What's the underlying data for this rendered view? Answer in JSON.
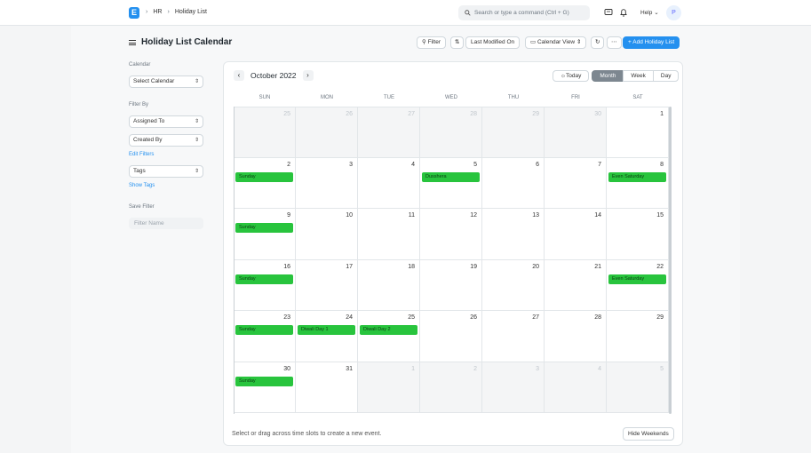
{
  "navbar": {
    "logo_letter": "E",
    "breadcrumbs": [
      "HR",
      "Holiday List"
    ],
    "search_placeholder": "Search or type a command (Ctrl + G)",
    "help_label": "Help",
    "avatar_initial": "P"
  },
  "page": {
    "title": "Holiday List Calendar",
    "toolbar": {
      "filter_label": "Filter",
      "sort_label": "Last Modified On",
      "view_label": "Calendar View",
      "add_label": "+ Add Holiday List"
    }
  },
  "sidebar": {
    "calendar_label": "Calendar",
    "select_calendar": "Select Calendar",
    "filter_by_label": "Filter By",
    "assigned_to": "Assigned To",
    "created_by": "Created By",
    "edit_filters": "Edit Filters",
    "tags": "Tags",
    "show_tags": "Show Tags",
    "save_filter_label": "Save Filter",
    "filter_name_placeholder": "Filter Name"
  },
  "calendar": {
    "month_title": "October 2022",
    "views": [
      "Today",
      "Month",
      "Week",
      "Day"
    ],
    "active_view": "Month",
    "weekdays": [
      "SUN",
      "MON",
      "TUE",
      "WED",
      "THU",
      "FRI",
      "SAT"
    ],
    "weeks": [
      [
        {
          "d": "25",
          "o": true
        },
        {
          "d": "26",
          "o": true
        },
        {
          "d": "27",
          "o": true
        },
        {
          "d": "28",
          "o": true
        },
        {
          "d": "29",
          "o": true
        },
        {
          "d": "30",
          "o": true
        },
        {
          "d": "1"
        }
      ],
      [
        {
          "d": "2",
          "e": "Sunday"
        },
        {
          "d": "3"
        },
        {
          "d": "4"
        },
        {
          "d": "5",
          "e": "Dusshera"
        },
        {
          "d": "6"
        },
        {
          "d": "7"
        },
        {
          "d": "8",
          "e": "Even Saturday"
        }
      ],
      [
        {
          "d": "9",
          "e": "Sunday"
        },
        {
          "d": "10"
        },
        {
          "d": "11"
        },
        {
          "d": "12"
        },
        {
          "d": "13"
        },
        {
          "d": "14"
        },
        {
          "d": "15"
        }
      ],
      [
        {
          "d": "16",
          "e": "Sunday"
        },
        {
          "d": "17"
        },
        {
          "d": "18"
        },
        {
          "d": "19"
        },
        {
          "d": "20"
        },
        {
          "d": "21"
        },
        {
          "d": "22",
          "e": "Even Saturday"
        }
      ],
      [
        {
          "d": "23",
          "e": "Sunday"
        },
        {
          "d": "24",
          "e": "Diwali Day 1"
        },
        {
          "d": "25",
          "e": "Diwali Day 2"
        },
        {
          "d": "26"
        },
        {
          "d": "27"
        },
        {
          "d": "28"
        },
        {
          "d": "29"
        }
      ],
      [
        {
          "d": "30",
          "e": "Sunday"
        },
        {
          "d": "31"
        },
        {
          "d": "1",
          "o": true
        },
        {
          "d": "2",
          "o": true
        },
        {
          "d": "3",
          "o": true
        },
        {
          "d": "4",
          "o": true
        },
        {
          "d": "5",
          "o": true
        }
      ]
    ],
    "footer_hint": "Select or drag across time slots to create a new event.",
    "hide_weekends_label": "Hide Weekends"
  },
  "colors": {
    "accent": "#2490ef",
    "event_green": "#28c43d"
  }
}
